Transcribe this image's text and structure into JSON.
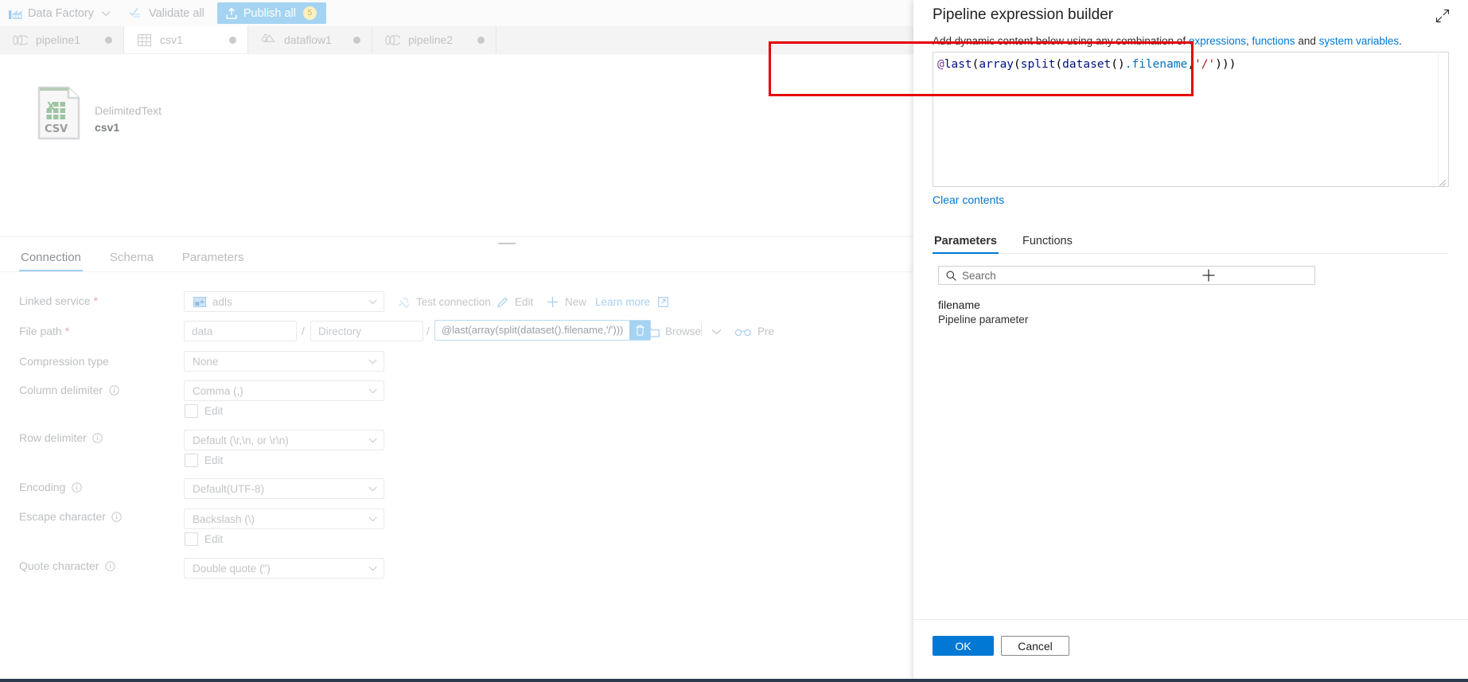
{
  "command_bar": {
    "brand_label": "Data Factory",
    "brand_icon": "factory-icon",
    "chevron_icon": "chevron-down-icon",
    "validate_all": "Validate all",
    "validate_icon": "checkmark-list-icon",
    "publish_all": "Publish all",
    "publish_icon": "publish-upload-icon",
    "publish_badge": "5"
  },
  "tabs": [
    {
      "label": "pipeline1",
      "icon": "pipeline-icon",
      "active": false
    },
    {
      "label": "csv1",
      "icon": "dataset-table-icon",
      "active": true
    },
    {
      "label": "dataflow1",
      "icon": "dataflow-icon",
      "active": false
    },
    {
      "label": "pipeline2",
      "icon": "pipeline-icon",
      "active": false
    }
  ],
  "dataset": {
    "icon": "csv-file-icon",
    "type": "DelimitedText",
    "name": "csv1"
  },
  "property_tabs": [
    {
      "label": "Connection",
      "active": true
    },
    {
      "label": "Schema",
      "active": false
    },
    {
      "label": "Parameters",
      "active": false
    }
  ],
  "form": {
    "linked_service": {
      "label": "Linked service",
      "required": "*",
      "value": "adls",
      "lead_icon": "linked-service-icon",
      "chevron_icon": "chevron-down-icon"
    },
    "actions": {
      "test_connection": "Test connection",
      "test_connection_icon": "plug-test-icon",
      "edit": "Edit",
      "edit_icon": "pencil-icon",
      "new": "New",
      "new_icon": "plus-icon",
      "learn_more": "Learn more",
      "learn_more_icon": "external-link-icon"
    },
    "file_path": {
      "label": "File path",
      "required": "*",
      "container": "data",
      "separator": "/",
      "directory_placeholder": "Directory",
      "expression": "@last(array(split(dataset().filename,'/')))",
      "clear_icon": "trash-icon",
      "browse_label": "Browse",
      "browse_icon": "folder-icon",
      "browse_chevron_icon": "chevron-down-icon",
      "preview_icon": "glasses-preview-icon",
      "preview_label": "Pre"
    },
    "compression_type": {
      "label": "Compression type",
      "value": "None",
      "chevron_icon": "chevron-down-icon"
    },
    "column_delimiter": {
      "label": "Column delimiter",
      "info_icon": "info-icon",
      "value": "Comma (,)",
      "chevron_icon": "chevron-down-icon",
      "edit_label": "Edit",
      "edit_checked": false
    },
    "row_delimiter": {
      "label": "Row delimiter",
      "info_icon": "info-icon",
      "value": "Default (\\r,\\n, or \\r\\n)",
      "chevron_icon": "chevron-down-icon",
      "edit_label": "Edit",
      "edit_checked": false
    },
    "encoding": {
      "label": "Encoding",
      "info_icon": "info-icon",
      "value": "Default(UTF-8)",
      "chevron_icon": "chevron-down-icon"
    },
    "escape_character": {
      "label": "Escape character",
      "info_icon": "info-icon",
      "value": "Backslash (\\)",
      "chevron_icon": "chevron-down-icon",
      "edit_label": "Edit",
      "edit_checked": false
    },
    "quote_character": {
      "label": "Quote character",
      "info_icon": "info-icon",
      "value": "Double quote (\")"
    }
  },
  "panel": {
    "title": "Pipeline expression builder",
    "expand_icon": "expand-diagonal-icon",
    "subtitle_pre": "Add dynamic content below using any combination of ",
    "subtitle_link1": "expressions",
    "subtitle_mid1": ", ",
    "subtitle_link2": "functions",
    "subtitle_mid2": " and ",
    "subtitle_link3": "system variables",
    "subtitle_post": ".",
    "expression": "@last(array(split(dataset().filename,'/')))",
    "expression_tokens": [
      {
        "text": "@",
        "type": "at"
      },
      {
        "text": "last",
        "type": "fn"
      },
      {
        "text": "(",
        "type": "punc"
      },
      {
        "text": "array",
        "type": "fn"
      },
      {
        "text": "(",
        "type": "punc"
      },
      {
        "text": "split",
        "type": "fn"
      },
      {
        "text": "(",
        "type": "punc"
      },
      {
        "text": "dataset",
        "type": "fn"
      },
      {
        "text": "()",
        "type": "punc"
      },
      {
        "text": ".filename",
        "type": "prop"
      },
      {
        "text": ",",
        "type": "punc"
      },
      {
        "text": "'/'",
        "type": "str"
      },
      {
        "text": ")))",
        "type": "punc"
      }
    ],
    "clear_contents": "Clear contents",
    "builder_tabs": [
      {
        "label": "Parameters",
        "active": true
      },
      {
        "label": "Functions",
        "active": false
      }
    ],
    "search_placeholder": "Search",
    "search_icon": "search-icon",
    "add_icon": "plus-icon",
    "parameters": [
      {
        "name": "filename",
        "kind": "Pipeline parameter"
      }
    ],
    "ok_label": "OK",
    "cancel_label": "Cancel"
  },
  "colors": {
    "accent_blue": "#0078d4",
    "disabled_blue": "#a5d3f2",
    "annotation_red": "#e60000",
    "badge_yellow": "#faf0c0"
  }
}
